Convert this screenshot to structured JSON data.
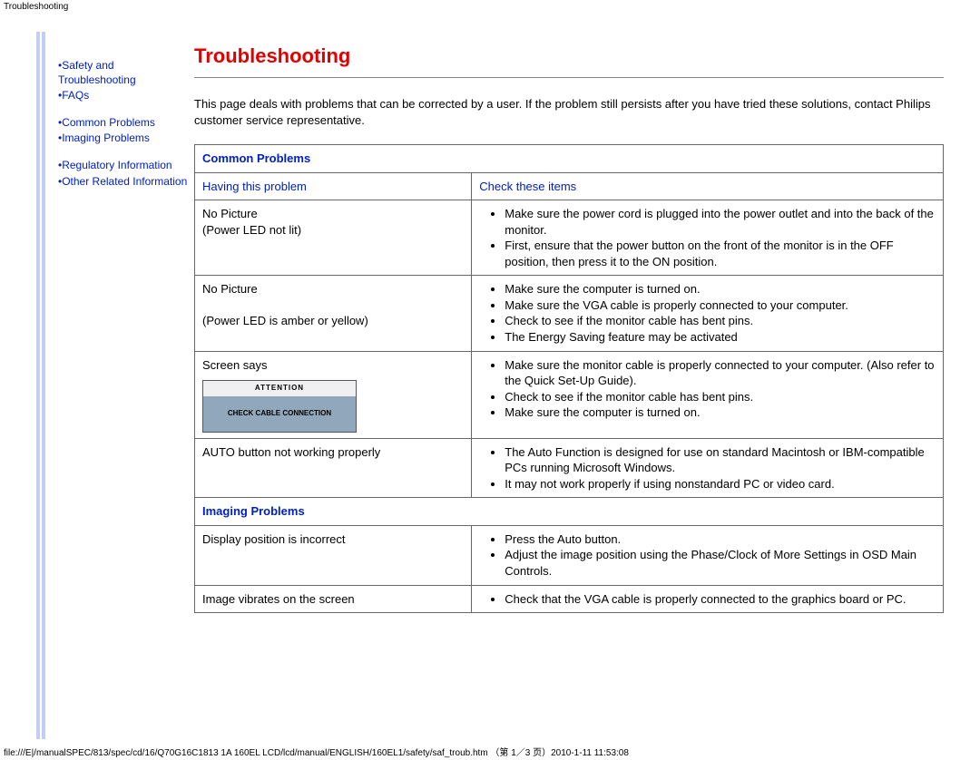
{
  "breadcrumb": "Troubleshooting",
  "sidebar": {
    "items": [
      "Safety and Troubleshooting",
      "FAQs",
      "Common Problems",
      "Imaging Problems",
      "Regulatory Information",
      "Other Related Information"
    ]
  },
  "title": "Troubleshooting",
  "intro": "This page deals with problems that can be corrected by a user. If the problem still persists after you have tried these solutions, contact Philips customer service representative.",
  "table": {
    "section1": "Common Problems",
    "head_left": "Having this problem",
    "head_right": "Check these items",
    "row1_left_l1": "No Picture",
    "row1_left_l2": "(Power LED not lit)",
    "row1_items": [
      "Make sure the power cord is plugged into the power outlet and into the back of the monitor.",
      "First, ensure that the power button on the front of the monitor is in the OFF position, then press it to the ON position."
    ],
    "row2_left_l1": "No Picture",
    "row2_left_l2": "(Power LED is amber or yellow)",
    "row2_items": [
      "Make sure the computer is turned on.",
      "Make sure the VGA cable is properly connected to your computer.",
      "Check to see if the monitor cable has bent pins.",
      "The Energy Saving feature may be activated"
    ],
    "row3_left": "Screen says",
    "row3_box_top": "ATTENTION",
    "row3_box_body": "CHECK CABLE CONNECTION",
    "row3_items": [
      "Make sure the monitor cable is properly connected to your computer. (Also refer to the Quick Set-Up Guide).",
      "Check to see if the monitor cable has bent pins.",
      "Make sure the computer is turned on."
    ],
    "row4_left": "AUTO button not working properly",
    "row4_items": [
      "The Auto Function is designed for use on standard Macintosh or IBM-compatible PCs running Microsoft Windows.",
      "It may not work properly if using nonstandard PC or video card."
    ],
    "section2": "Imaging Problems",
    "row5_left": "Display position is incorrect",
    "row5_items": [
      "Press the Auto button.",
      "Adjust the image position using the Phase/Clock of More Settings in OSD Main Controls."
    ],
    "row6_left": "Image vibrates on the screen",
    "row6_items": [
      "Check that the VGA cable is properly connected to the graphics board or PC."
    ]
  },
  "footer": "file:///E|/manualSPEC/813/spec/cd/16/Q70G16C1813 1A 160EL LCD/lcd/manual/ENGLISH/160EL1/safety/saf_troub.htm （第 1／3 页）2010-1-11 11:53:08"
}
